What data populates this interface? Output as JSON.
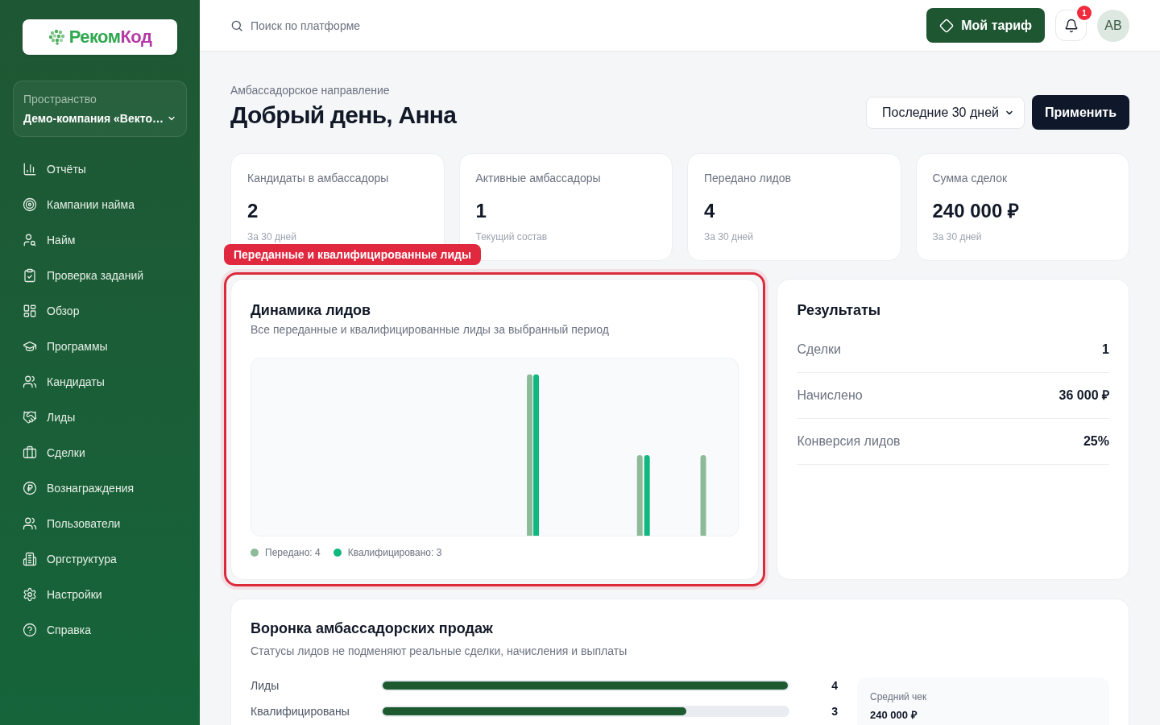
{
  "sidebar": {
    "logo": {
      "parts": [
        "Реком",
        "Код"
      ]
    },
    "workspace": {
      "label": "Пространство",
      "name": "Демо-компания «Векто…"
    },
    "nav": [
      {
        "label": "Отчёты"
      },
      {
        "label": "Кампании найма"
      },
      {
        "label": "Найм"
      },
      {
        "label": "Проверка заданий"
      },
      {
        "label": "Обзор"
      },
      {
        "label": "Программы"
      },
      {
        "label": "Кандидаты"
      },
      {
        "label": "Лиды"
      },
      {
        "label": "Сделки"
      },
      {
        "label": "Вознаграждения"
      },
      {
        "label": "Пользователи"
      },
      {
        "label": "Оргструктура"
      },
      {
        "label": "Настройки"
      },
      {
        "label": "Справка"
      }
    ]
  },
  "topbar": {
    "search": {
      "placeholder": "Поиск по платформе"
    },
    "plan_button": "Мой тариф",
    "notifications": {
      "count": "1"
    },
    "avatar": {
      "initials": "АВ"
    }
  },
  "header": {
    "section": "Амбассадорское направление",
    "greeting": "Добрый день, Анна",
    "period": {
      "value": "Последние 30 дней"
    },
    "apply_button": "Применить"
  },
  "stats": [
    {
      "label": "Кандидаты в амбассадоры",
      "value": "2",
      "note": "За 30 дней"
    },
    {
      "label": "Активные амбассадоры",
      "value": "1",
      "note": "Текущий состав"
    },
    {
      "label": "Передано лидов",
      "value": "4",
      "note": "За 30 дней"
    },
    {
      "label": "Сумма сделок",
      "value": "240 000 ₽",
      "note": "За 30 дней"
    }
  ],
  "lead_chart": {
    "highlighted": true,
    "highlight_label": "Переданные и квалифицированные лиды",
    "title": "Динамика лидов",
    "subtitle": "Все переданные и квалифицированные лиды за выбранный период",
    "legend": [
      {
        "label": "Передано: 4",
        "color": "#8dbb98"
      },
      {
        "label": "Квалифицировано: 3",
        "color": "#10b77f"
      }
    ]
  },
  "results": {
    "title": "Результаты",
    "rows": [
      {
        "label": "Сделки",
        "value": "1"
      },
      {
        "label": "Начислено",
        "value": "36 000 ₽"
      },
      {
        "label": "Конверсия лидов",
        "value": "25%"
      }
    ]
  },
  "funnel": {
    "title": "Воронка амбассадорских продаж",
    "subtitle": "Статусы лидов не подменяют реальные сделки, начисления и выплаты",
    "rows": [
      {
        "label": "Лиды",
        "level": 1,
        "value": "4"
      },
      {
        "label": "Квалифицированы",
        "level": 0.75,
        "value": "3"
      }
    ],
    "summary": {
      "label": "Средний чек",
      "value": "240 000 ₽"
    }
  }
}
